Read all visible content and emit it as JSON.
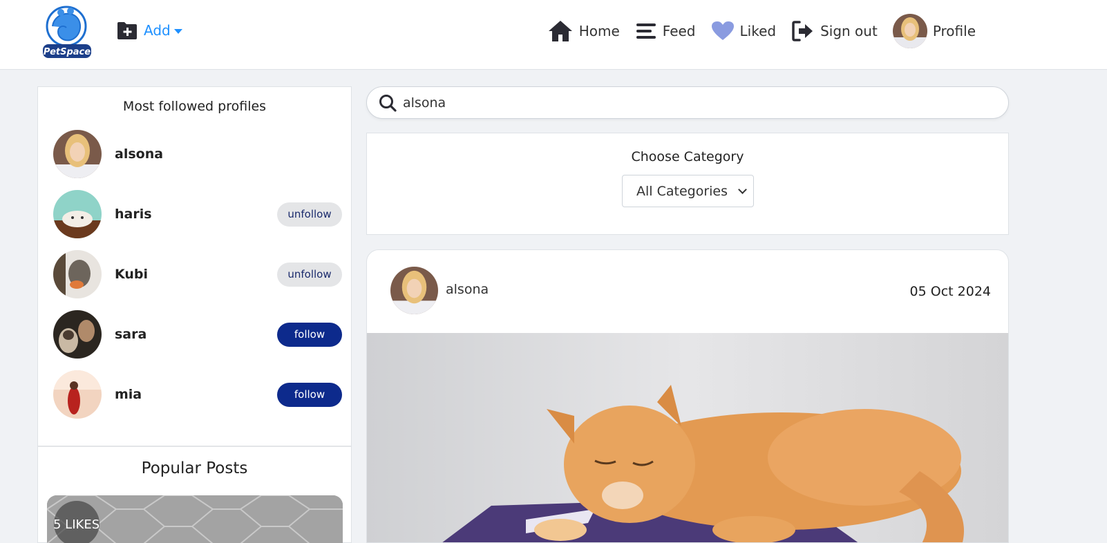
{
  "navbar": {
    "logo_text": "PetSpace",
    "add_label": "Add",
    "links": {
      "home": "Home",
      "feed": "Feed",
      "liked": "Liked",
      "sign_out": "Sign out",
      "profile": "Profile"
    }
  },
  "sidebar": {
    "title": "Most followed profiles",
    "profiles": [
      {
        "name": "alsona",
        "action": ""
      },
      {
        "name": "haris",
        "action": "unfollow"
      },
      {
        "name": "Kubi",
        "action": "unfollow"
      },
      {
        "name": "sara",
        "action": "follow"
      },
      {
        "name": "mia",
        "action": "follow"
      }
    ],
    "popular_title": "Popular Posts",
    "popular_post": {
      "likes": "5 LIKES"
    }
  },
  "search": {
    "value": "alsona"
  },
  "category": {
    "title": "Choose Category",
    "selected": "All Categories"
  },
  "post": {
    "author": "alsona",
    "date": "05 Oct 2024"
  },
  "colors": {
    "accent_blue": "#1e90ff",
    "follow_button": "#0d2a8c",
    "unfollow_button": "#e4e5e7",
    "liked_heart": "#8a9be0",
    "page_background": "#f0f2f5"
  }
}
